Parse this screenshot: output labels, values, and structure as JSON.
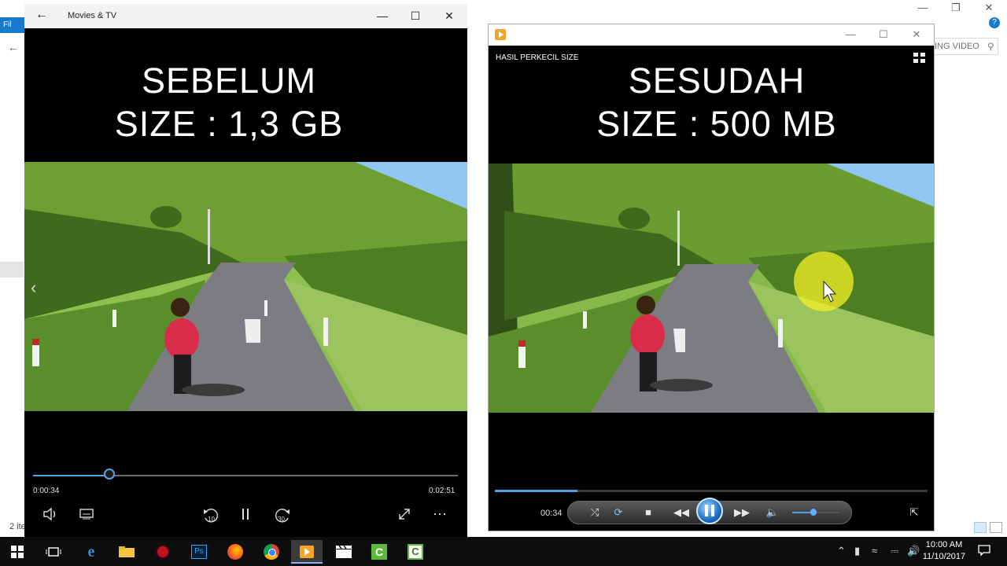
{
  "explorer": {
    "tab_label": "Fil",
    "search_placeholder": "ING VIDEO",
    "status": "2 ite"
  },
  "movies_tv": {
    "title": "Movies & TV",
    "overlay_line1": "SEBELUM",
    "overlay_line2": "SIZE : 1,3 GB",
    "time_current": "0:00:34",
    "time_total": "0:02:51",
    "progress_fraction": 0.18,
    "rewind_label": "10",
    "forward_label": "30"
  },
  "media_player": {
    "video_title": "HASIL PERKECIL SIZE",
    "overlay_line1": "SESUDAH",
    "overlay_line2": "SIZE : 500 MB",
    "time_current": "00:34",
    "progress_fraction": 0.19,
    "volume_fraction": 0.45
  },
  "taskbar": {
    "time": "10:00 AM",
    "date": "11/10/2017",
    "apps": [
      "windows-start",
      "task-view",
      "edge",
      "file-explorer",
      "app-red",
      "photoshop",
      "firefox",
      "chrome",
      "media-player",
      "clapperboard",
      "camtasia-recorder",
      "camtasia-studio"
    ]
  },
  "colors": {
    "seek_blue": "#4ea0e6",
    "explorer_tab": "#1979ca"
  }
}
